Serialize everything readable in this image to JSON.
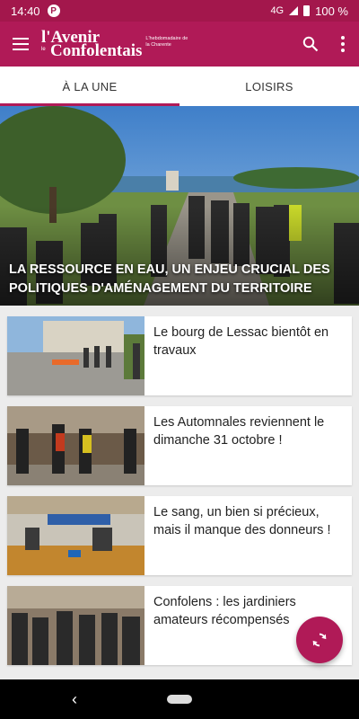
{
  "status_bar": {
    "time": "14:40",
    "network": "4G",
    "battery": "100 %",
    "app_icon_letter": "P"
  },
  "app_bar": {
    "logo_line1": "l'Avenir",
    "logo_small": "le",
    "logo_line2": "Confolentais",
    "tagline": "L'hebdomadaire de la Charente",
    "menu_icon": "menu-icon",
    "search_icon": "search-icon",
    "overflow_icon": "more-vert-icon",
    "brand_color": "#b01a57"
  },
  "tabs": [
    {
      "label": "À LA UNE",
      "active": true
    },
    {
      "label": "LOISIRS",
      "active": false
    }
  ],
  "hero": {
    "title": "LA RESSOURCE EN EAU, UN ENJEU CRUCIAL DES POLITIQUES D'AMÉNAGEMENT DU TERRITOIRE"
  },
  "articles": [
    {
      "title": "Le bourg de Lessac bientôt en travaux"
    },
    {
      "title": "Les Automnales reviennent le dimanche 31 octobre !"
    },
    {
      "title": "Le sang, un bien si précieux, mais il manque des donneurs !"
    },
    {
      "title": "Confolens : les jardiniers amateurs récompensés"
    }
  ],
  "fab": {
    "icon": "refresh-icon"
  },
  "nav": {
    "back_icon": "back-icon",
    "home_icon": "home-pill-icon"
  }
}
